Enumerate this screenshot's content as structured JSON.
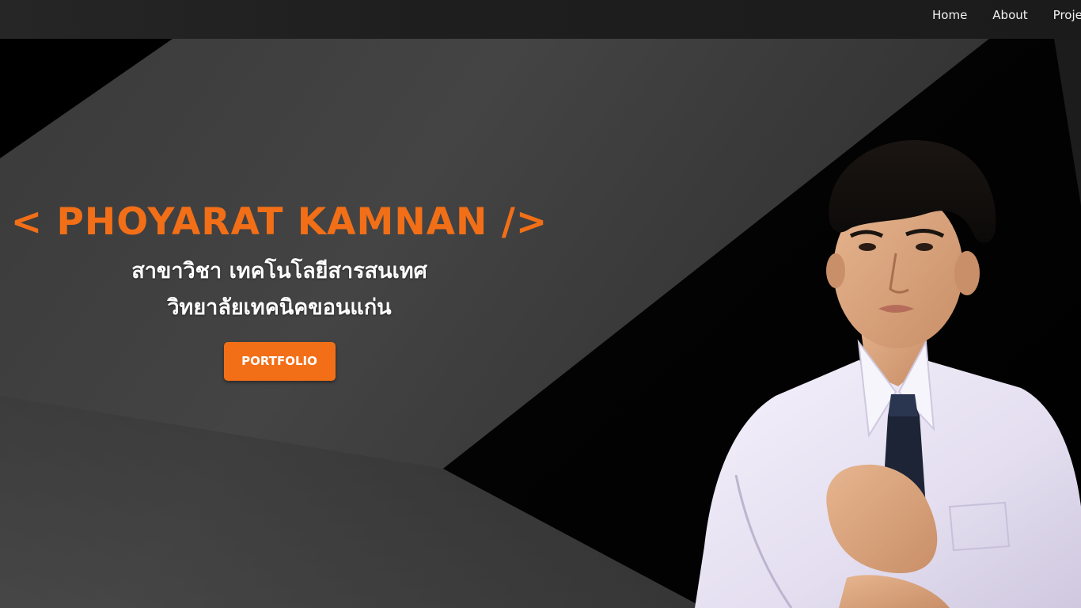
{
  "nav": {
    "links": [
      "Home",
      "About",
      "Proje"
    ]
  },
  "hero": {
    "name": "< PHOYARAT KAMNAN />",
    "line1": "สาขาวิชา เทคโนโลยีสารสนเทศ",
    "line2": "วิทยาลัยเทคนิคขอนแก่น",
    "button_label": "PORTFOLIO"
  },
  "colors": {
    "accent": "#f26f17",
    "background": "#000000",
    "nav_bg": "#1e1e1e"
  }
}
